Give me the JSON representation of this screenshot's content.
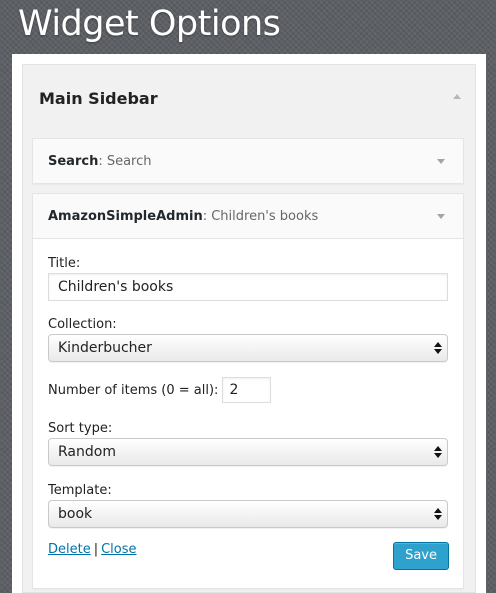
{
  "page": {
    "heading": "Widget Options"
  },
  "sidebar": {
    "title": "Main Sidebar"
  },
  "widgets": [
    {
      "name": "Search",
      "separator": ": ",
      "instance_title": "Search"
    },
    {
      "name": "AmazonSimpleAdmin",
      "separator": ": ",
      "instance_title": "Children's books",
      "form": {
        "title_label": "Title:",
        "title_value": "Children's books",
        "collection_label": "Collection:",
        "collection_value": "Kinderbucher",
        "num_items_label": "Number of items (0 = all):",
        "num_items_value": "2",
        "sort_label": "Sort type:",
        "sort_value": "Random",
        "template_label": "Template:",
        "template_value": "book",
        "delete_label": "Delete",
        "link_separator": "|",
        "close_label": "Close",
        "save_label": "Save"
      }
    }
  ],
  "colors": {
    "background": "#5b5e63",
    "accent": "#2ea2cc",
    "link": "#0073aa"
  },
  "icons": {
    "collapse": "arrow-up-icon",
    "expand": "arrow-down-icon",
    "select": "select-arrows-icon"
  }
}
